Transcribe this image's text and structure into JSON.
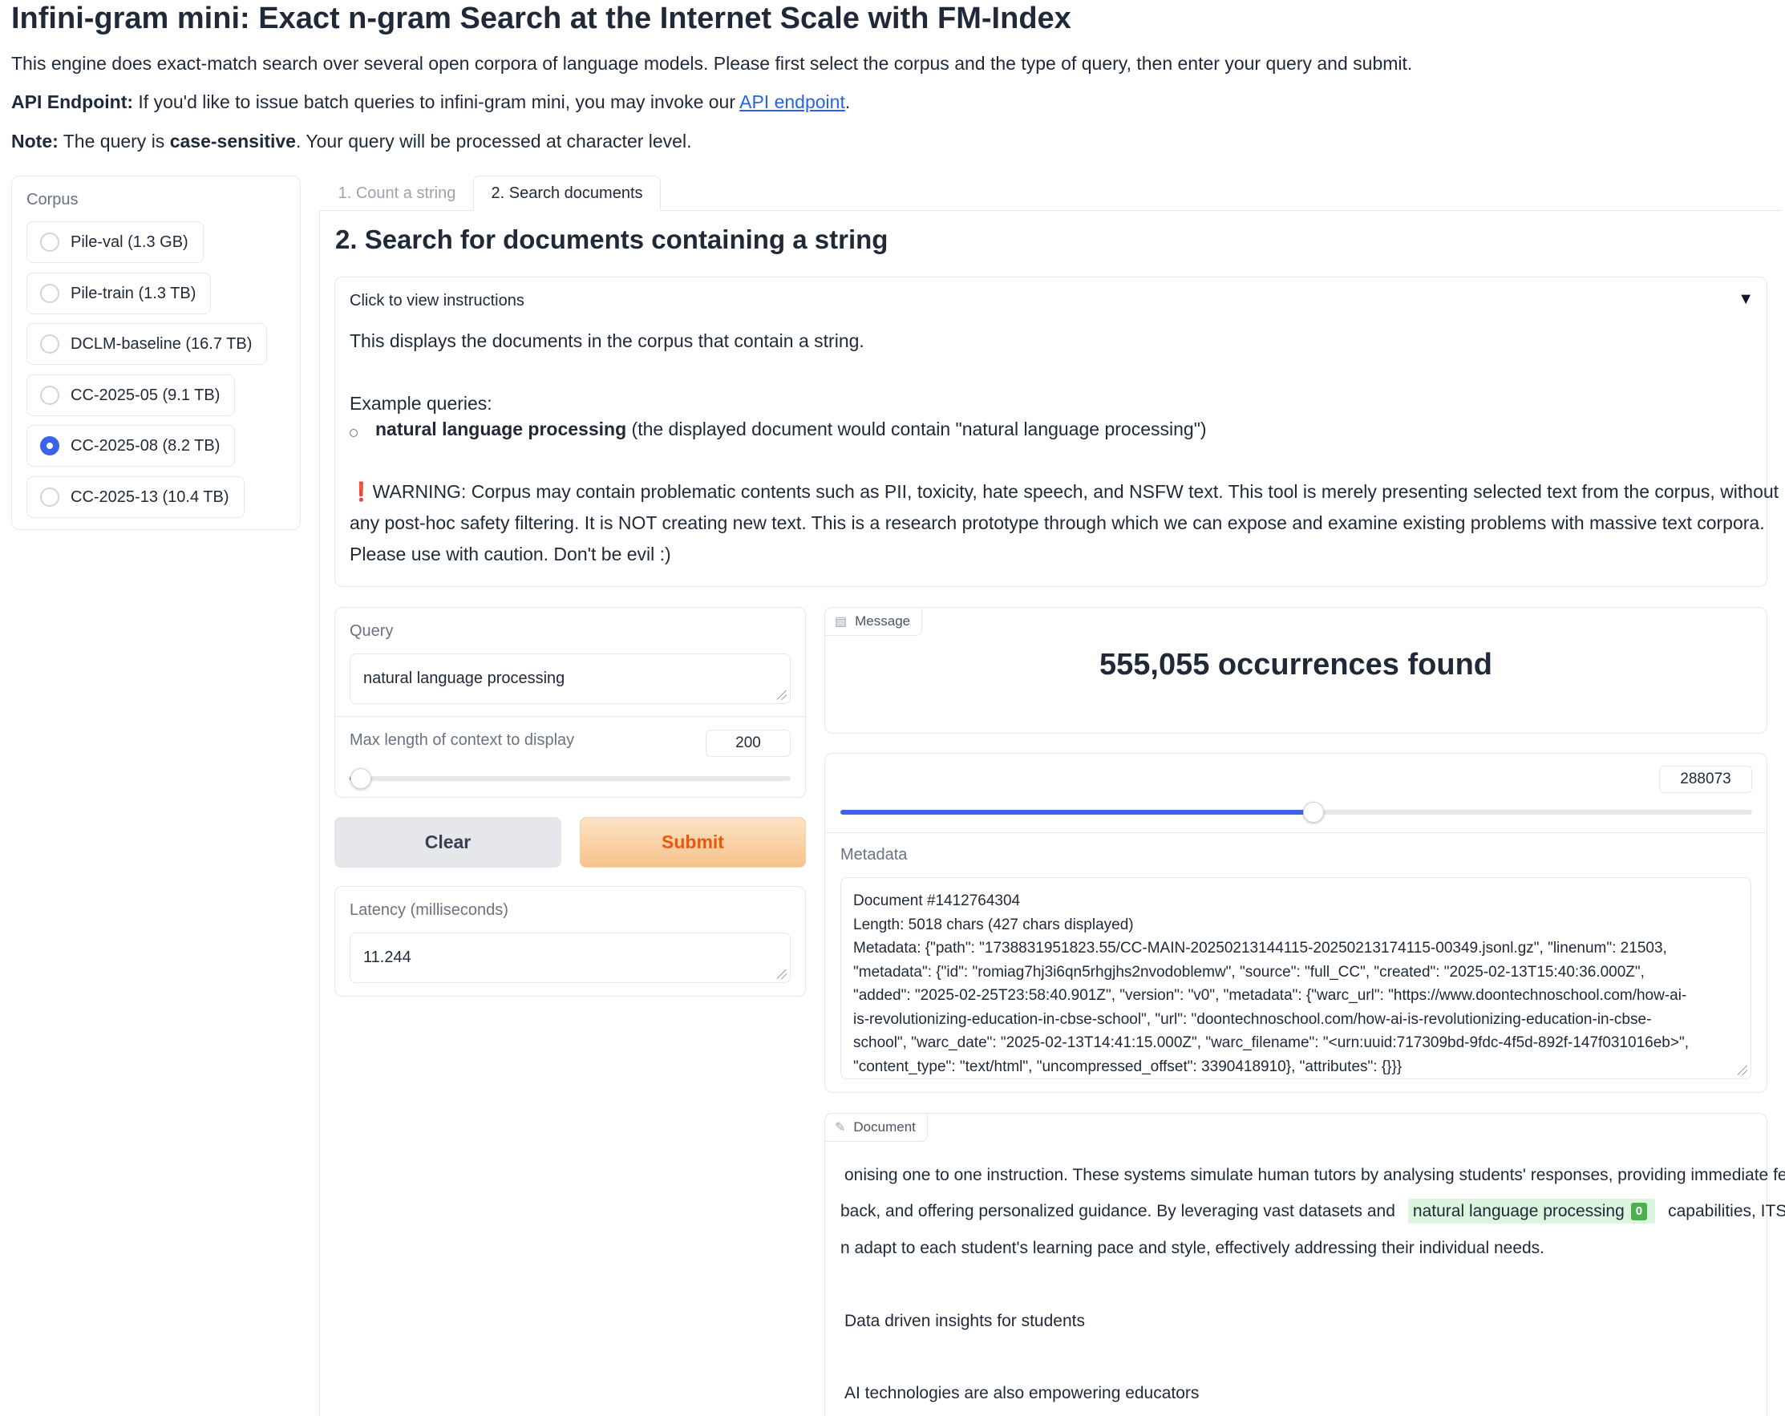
{
  "header": {
    "title": "Infini-gram mini: Exact n-gram Search at the Internet Scale with FM-Index",
    "intro": "This engine does exact-match search over several open corpora of language models. Please first select the corpus and the type of query, then enter your query and submit.",
    "api_label": "API Endpoint:",
    "api_text": " If you'd like to issue batch queries to infini-gram mini, you may invoke our ",
    "api_link": "API endpoint",
    "api_end": ".",
    "note_label": "Note:",
    "note_text1": " The query is ",
    "note_bold": "case-sensitive",
    "note_text2": ". Your query will be processed at character level."
  },
  "corpus": {
    "label": "Corpus",
    "options": [
      {
        "label": "Pile-val (1.3 GB)",
        "checked": false
      },
      {
        "label": "Pile-train (1.3 TB)",
        "checked": false
      },
      {
        "label": "DCLM-baseline (16.7 TB)",
        "checked": false
      },
      {
        "label": "CC-2025-05 (9.1 TB)",
        "checked": false
      },
      {
        "label": "CC-2025-08 (8.2 TB)",
        "checked": true
      },
      {
        "label": "CC-2025-13 (10.4 TB)",
        "checked": false
      }
    ]
  },
  "tabs": [
    {
      "label": "1. Count a string",
      "active": false
    },
    {
      "label": "2. Search documents",
      "active": true
    }
  ],
  "section_title": "2. Search for documents containing a string",
  "instructions": {
    "toggle": "Click to view instructions",
    "arrow": "▼",
    "line1": "This displays the documents in the corpus that contain a string.",
    "example_heading": "Example queries:",
    "example_bold": "natural language processing",
    "example_rest": " (the displayed document would contain \"natural language processing\")",
    "warning_mark": "❗",
    "warning_l1": "WARNING: Corpus may contain problematic contents such as PII, toxicity, hate speech, and NSFW text. This tool is merely presenting selected text from the corpus, without",
    "warning_l2": "any post-hoc safety filtering. It is NOT creating new text. This is a research prototype through which we can expose and examine existing problems with massive text corpora.",
    "warning_l3": "Please use with caution. Don't be evil :)"
  },
  "query": {
    "label": "Query",
    "value": "natural language processing",
    "max_len_label": "Max length of context to display",
    "max_len_value": "200",
    "max_len_fraction": 0.026
  },
  "buttons": {
    "clear": "Clear",
    "submit": "Submit"
  },
  "latency": {
    "label": "Latency (milliseconds)",
    "value": "11.244"
  },
  "message": {
    "tag": "Message",
    "text": "555,055 occurrences found"
  },
  "result_slider": {
    "value": "288073",
    "fraction": 0.519
  },
  "metadata": {
    "label": "Metadata",
    "lines": [
      "Document #1412764304",
      "Length: 5018 chars (427 chars displayed)",
      "Metadata: {\"path\": \"1738831951823.55/CC-MAIN-20250213144115-20250213174115-00349.jsonl.gz\", \"linenum\": 21503,",
      "\"metadata\": {\"id\": \"romiag7hj3i6qn5rhgjhs2nvodoblemw\", \"source\": \"full_CC\", \"created\": \"2025-02-13T15:40:36.000Z\",",
      "\"added\": \"2025-02-25T23:58:40.901Z\", \"version\": \"v0\", \"metadata\": {\"warc_url\": \"https://www.doontechnoschool.com/how-ai-",
      "is-revolutionizing-education-in-cbse-school\", \"url\": \"doontechnoschool.com/how-ai-is-revolutionizing-education-in-cbse-",
      "school\", \"warc_date\": \"2025-02-13T14:41:15.000Z\", \"warc_filename\": \"<urn:uuid:717309bd-9fdc-4f5d-892f-147f031016eb>\",",
      "\"content_type\": \"text/html\", \"uncompressed_offset\": 3390418910}, \"attributes\": {}}}"
    ]
  },
  "document": {
    "tag": "Document",
    "line1": "onising one to one instruction. These systems simulate human tutors by analysing students' responses, providing immediate feed",
    "line2_pre": "back, and offering personalized guidance. By leveraging vast datasets and",
    "line2_hl": "natural language processing",
    "line2_badge": "0",
    "line2_post": "capabilities, ITS ca",
    "line3": "n adapt to each student's learning pace and style, effectively addressing their individual needs.",
    "line4": "Data driven insights for students",
    "line5": "AI technologies are also empowering educators"
  },
  "colors": {
    "accent": "#3b63e8",
    "submit_text": "#ea580c",
    "highlight": "#dcf5df",
    "badge": "#4caf50",
    "link": "#2563eb",
    "warning": "#dc2626"
  }
}
